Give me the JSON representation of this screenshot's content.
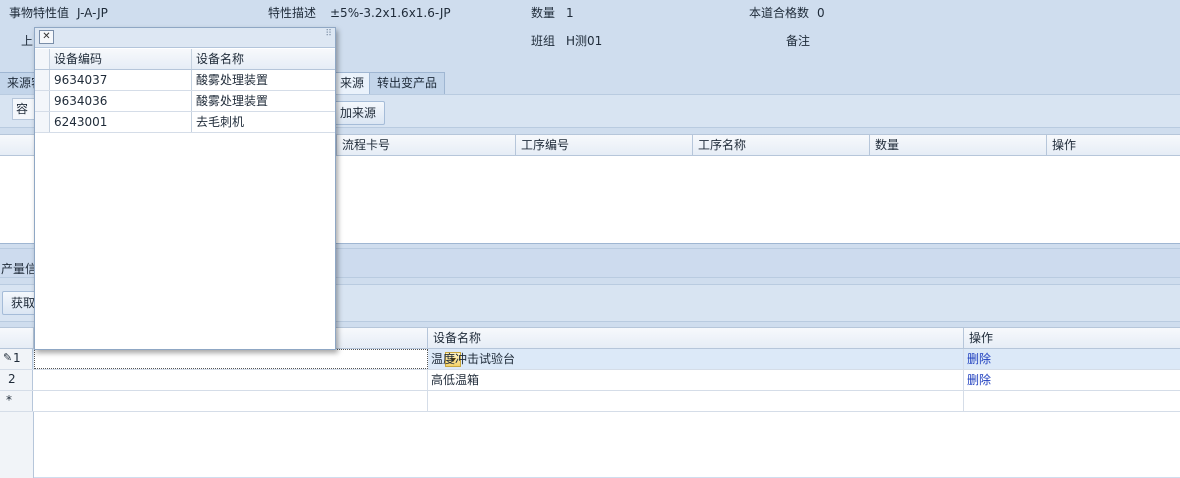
{
  "header": {
    "item_value_label": "事物特性值",
    "item_value": "J-A-JP",
    "feature_desc_label": "特性描述",
    "feature_desc": "±5%-3.2x1.6x1.6-JP",
    "quantity_label": "数量",
    "quantity": "1",
    "pass_count_label": "本道合格数",
    "pass_count": "0",
    "upper_partial_label": "上",
    "group_label": "班组",
    "group_value": "H测01",
    "remark_label": "备注"
  },
  "tabs": [
    "来源容",
    "来源",
    "转出变产品"
  ],
  "source_section": {
    "left_cell": "容",
    "add_source_button": "加来源",
    "columns": [
      "流程卡号",
      "工序编号",
      "工序名称",
      "数量",
      "操作"
    ]
  },
  "output_section": {
    "title_partial": "产量信",
    "fetch_button_partial": "获取",
    "columns": [
      "设备名称",
      "操作"
    ],
    "rows": [
      {
        "indicator": "1",
        "name": "温度冲击试验台",
        "action": "删除"
      },
      {
        "indicator": "2",
        "name": "高低温箱",
        "action": "删除"
      },
      {
        "indicator": "*",
        "name": "",
        "action": ""
      }
    ]
  },
  "popup": {
    "close_glyph": "✕",
    "columns": [
      "设备编码",
      "设备名称"
    ],
    "rows": [
      {
        "code": "9634037",
        "name": "酸雾处理装置"
      },
      {
        "code": "9634036",
        "name": "酸雾处理装置"
      },
      {
        "code": "6243001",
        "name": "去毛刺机"
      }
    ]
  }
}
